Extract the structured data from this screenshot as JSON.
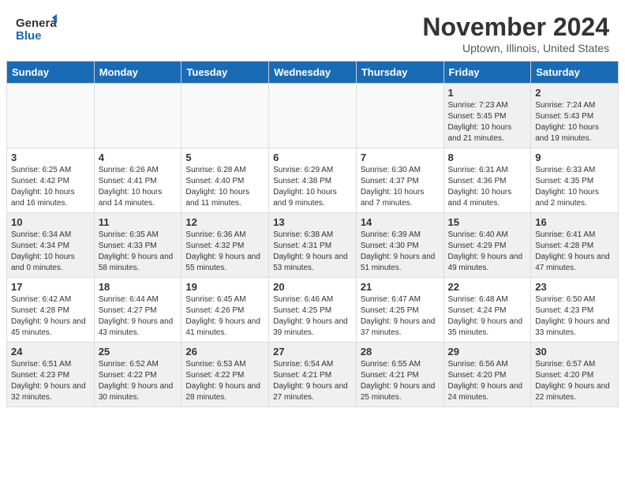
{
  "logo": {
    "text_general": "General",
    "text_blue": "Blue"
  },
  "title": "November 2024",
  "subtitle": "Uptown, Illinois, United States",
  "weekdays": [
    "Sunday",
    "Monday",
    "Tuesday",
    "Wednesday",
    "Thursday",
    "Friday",
    "Saturday"
  ],
  "weeks": [
    [
      {
        "day": "",
        "info": ""
      },
      {
        "day": "",
        "info": ""
      },
      {
        "day": "",
        "info": ""
      },
      {
        "day": "",
        "info": ""
      },
      {
        "day": "",
        "info": ""
      },
      {
        "day": "1",
        "info": "Sunrise: 7:23 AM\nSunset: 5:45 PM\nDaylight: 10 hours and 21 minutes."
      },
      {
        "day": "2",
        "info": "Sunrise: 7:24 AM\nSunset: 5:43 PM\nDaylight: 10 hours and 19 minutes."
      }
    ],
    [
      {
        "day": "3",
        "info": "Sunrise: 6:25 AM\nSunset: 4:42 PM\nDaylight: 10 hours and 16 minutes."
      },
      {
        "day": "4",
        "info": "Sunrise: 6:26 AM\nSunset: 4:41 PM\nDaylight: 10 hours and 14 minutes."
      },
      {
        "day": "5",
        "info": "Sunrise: 6:28 AM\nSunset: 4:40 PM\nDaylight: 10 hours and 11 minutes."
      },
      {
        "day": "6",
        "info": "Sunrise: 6:29 AM\nSunset: 4:38 PM\nDaylight: 10 hours and 9 minutes."
      },
      {
        "day": "7",
        "info": "Sunrise: 6:30 AM\nSunset: 4:37 PM\nDaylight: 10 hours and 7 minutes."
      },
      {
        "day": "8",
        "info": "Sunrise: 6:31 AM\nSunset: 4:36 PM\nDaylight: 10 hours and 4 minutes."
      },
      {
        "day": "9",
        "info": "Sunrise: 6:33 AM\nSunset: 4:35 PM\nDaylight: 10 hours and 2 minutes."
      }
    ],
    [
      {
        "day": "10",
        "info": "Sunrise: 6:34 AM\nSunset: 4:34 PM\nDaylight: 10 hours and 0 minutes."
      },
      {
        "day": "11",
        "info": "Sunrise: 6:35 AM\nSunset: 4:33 PM\nDaylight: 9 hours and 58 minutes."
      },
      {
        "day": "12",
        "info": "Sunrise: 6:36 AM\nSunset: 4:32 PM\nDaylight: 9 hours and 55 minutes."
      },
      {
        "day": "13",
        "info": "Sunrise: 6:38 AM\nSunset: 4:31 PM\nDaylight: 9 hours and 53 minutes."
      },
      {
        "day": "14",
        "info": "Sunrise: 6:39 AM\nSunset: 4:30 PM\nDaylight: 9 hours and 51 minutes."
      },
      {
        "day": "15",
        "info": "Sunrise: 6:40 AM\nSunset: 4:29 PM\nDaylight: 9 hours and 49 minutes."
      },
      {
        "day": "16",
        "info": "Sunrise: 6:41 AM\nSunset: 4:28 PM\nDaylight: 9 hours and 47 minutes."
      }
    ],
    [
      {
        "day": "17",
        "info": "Sunrise: 6:42 AM\nSunset: 4:28 PM\nDaylight: 9 hours and 45 minutes."
      },
      {
        "day": "18",
        "info": "Sunrise: 6:44 AM\nSunset: 4:27 PM\nDaylight: 9 hours and 43 minutes."
      },
      {
        "day": "19",
        "info": "Sunrise: 6:45 AM\nSunset: 4:26 PM\nDaylight: 9 hours and 41 minutes."
      },
      {
        "day": "20",
        "info": "Sunrise: 6:46 AM\nSunset: 4:25 PM\nDaylight: 9 hours and 39 minutes."
      },
      {
        "day": "21",
        "info": "Sunrise: 6:47 AM\nSunset: 4:25 PM\nDaylight: 9 hours and 37 minutes."
      },
      {
        "day": "22",
        "info": "Sunrise: 6:48 AM\nSunset: 4:24 PM\nDaylight: 9 hours and 35 minutes."
      },
      {
        "day": "23",
        "info": "Sunrise: 6:50 AM\nSunset: 4:23 PM\nDaylight: 9 hours and 33 minutes."
      }
    ],
    [
      {
        "day": "24",
        "info": "Sunrise: 6:51 AM\nSunset: 4:23 PM\nDaylight: 9 hours and 32 minutes."
      },
      {
        "day": "25",
        "info": "Sunrise: 6:52 AM\nSunset: 4:22 PM\nDaylight: 9 hours and 30 minutes."
      },
      {
        "day": "26",
        "info": "Sunrise: 6:53 AM\nSunset: 4:22 PM\nDaylight: 9 hours and 28 minutes."
      },
      {
        "day": "27",
        "info": "Sunrise: 6:54 AM\nSunset: 4:21 PM\nDaylight: 9 hours and 27 minutes."
      },
      {
        "day": "28",
        "info": "Sunrise: 6:55 AM\nSunset: 4:21 PM\nDaylight: 9 hours and 25 minutes."
      },
      {
        "day": "29",
        "info": "Sunrise: 6:56 AM\nSunset: 4:20 PM\nDaylight: 9 hours and 24 minutes."
      },
      {
        "day": "30",
        "info": "Sunrise: 6:57 AM\nSunset: 4:20 PM\nDaylight: 9 hours and 22 minutes."
      }
    ]
  ]
}
